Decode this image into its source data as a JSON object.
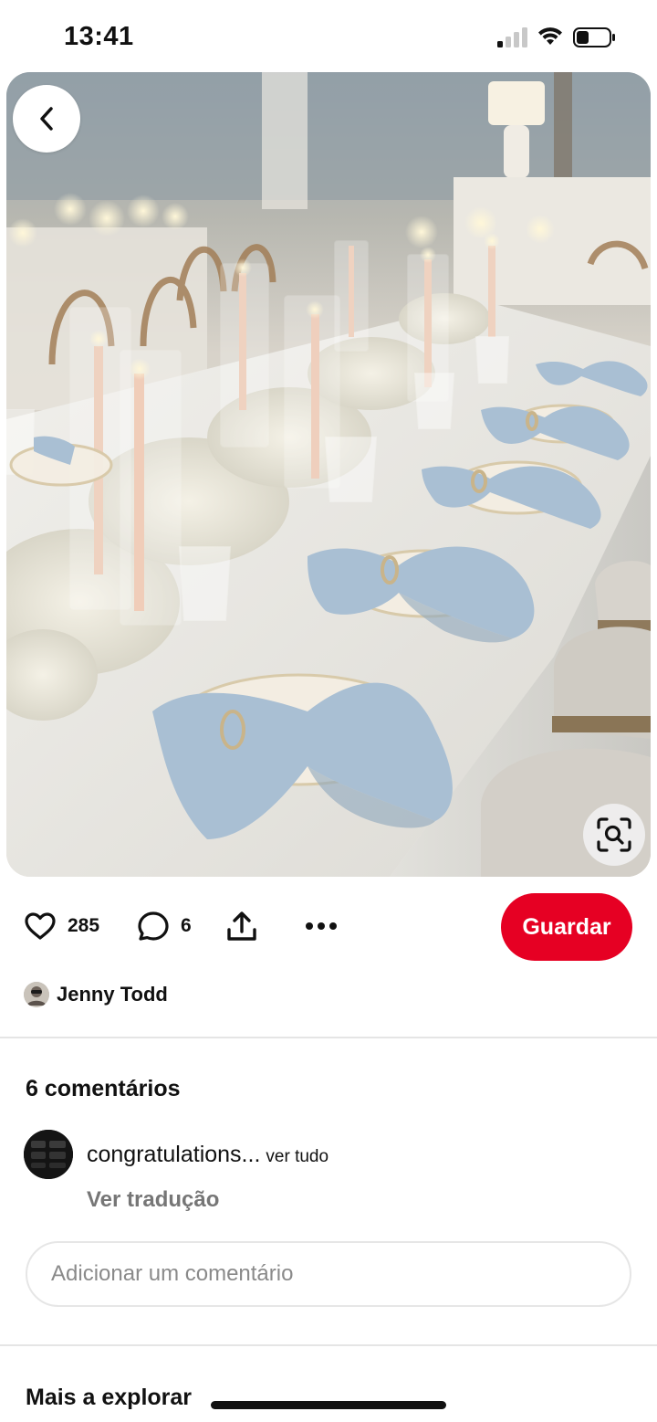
{
  "status_bar": {
    "time": "13:41",
    "signal_bars_active": 1,
    "battery_level": 0.35
  },
  "pin": {
    "image_icons": {
      "back": "chevron-left-icon",
      "visual_search": "visual-search-lens-icon"
    },
    "likes": "285",
    "comment_count": "6",
    "save_label": "Guardar",
    "author": "Jenny Todd"
  },
  "comments": {
    "title": "6 comentários",
    "first": {
      "text": "congratulations...",
      "more": "ver tudo"
    },
    "translate": "Ver tradução",
    "input_placeholder": "Adicionar um comentário"
  },
  "explore": {
    "title": "Mais a explorar"
  },
  "colors": {
    "accent": "#e60023",
    "napkin": "#a9bfd3",
    "tablecloth": "#ecebe6"
  }
}
